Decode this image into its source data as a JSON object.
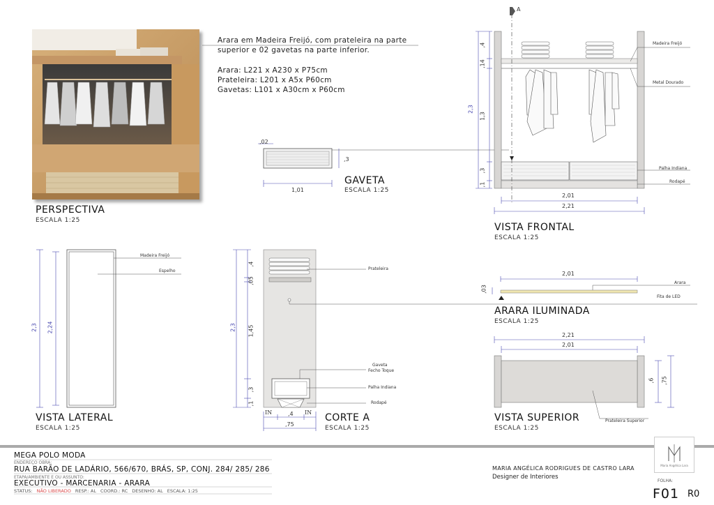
{
  "note": {
    "line1": "Arara em Madeira Freijó, com prateleira na parte",
    "line2": "superior e 02 gavetas na parte inferior.",
    "spec1": "Arara: L221 x A230 x P75cm",
    "spec2": "Prateleira: L201 x A5x P60cm",
    "spec3": "Gavetas: L101 x A30cm x P60cm"
  },
  "views": {
    "perspectiva": {
      "title": "PERSPECTIVA",
      "scale": "ESCALA 1:25"
    },
    "gaveta": {
      "title": "GAVETA",
      "scale": "ESCALA 1:25",
      "dim_w": "1,01",
      "dim_h": ",3",
      "dim_t": ",02"
    },
    "frontal": {
      "title": "VISTA FRONTAL",
      "scale": "ESCALA 1:25",
      "dim_inner": "2,01",
      "dim_outer": "2,21",
      "dim_h_total": "2,3",
      "dim_top": ",4",
      "dim_gap": ",14",
      "dim_mid": "1,3",
      "dim_drawer": ",3",
      "dim_base": ",1",
      "label_madeira": "Madeira Freijó",
      "label_metal": "Metal Dourado",
      "label_palha": "Palha Indiana",
      "label_rodape": "Rodapé",
      "section_mark": "A"
    },
    "lateral": {
      "title": "VISTA LATERAL",
      "scale": "ESCALA 1:25",
      "dim_total": "2,3",
      "dim_mirror": "2,24",
      "label_madeira": "Madeira Freijó",
      "label_espelho": "Espelho"
    },
    "corte": {
      "title": "CORTE A",
      "scale": "ESCALA 1:25",
      "dim_h_total": "2,3",
      "dim_top": ",4",
      "dim_shelf": ",05",
      "dim_mid": "1,45",
      "dim_drawer": ",3",
      "dim_base": ",1",
      "dim_drawer_w": ",4",
      "dim_depth": ",75",
      "in_left": "IN",
      "in_right": "IN",
      "label_prateleira": "Prateleira",
      "label_gaveta": "Gaveta",
      "label_fecho": "Fecho Toque",
      "label_palha": "Palha Indiana",
      "label_rodape": "Rodapé"
    },
    "arara": {
      "title": "ARARA ILUMINADA",
      "scale": "ESCALA 1:25",
      "dim_w": "2,01",
      "dim_h": ",03",
      "label_arara": "Arara",
      "label_led": "Fita de LED"
    },
    "superior": {
      "title": "VISTA SUPERIOR",
      "scale": "ESCALA 1:25",
      "dim_outer": "2,21",
      "dim_inner": "2,01",
      "dim_d1": ",6",
      "dim_d2": ",75",
      "label_prateleira": "Prateleira Superior"
    }
  },
  "titleblock": {
    "project": "MEGA POLO MODA",
    "addr_label": "ENDEREÇO OBRA:",
    "address": "RUA BARÃO DE LADÁRIO, 566/670, BRÁS, SP, CONJ. 284/ 285/ 286",
    "stage_label": "ETAPA/AMBIENTE E OU ASSUNTO:",
    "stage": "EXECUTIVO - MARCENARIA - ARARA",
    "status_label": "STATUS:",
    "status": "NÃO LIBERADO",
    "resp": "RESP.: AL",
    "coord": "COORD.: RC",
    "desenho": "DESENHO: AL",
    "escala": "ESCALA: 1:25",
    "designer": "MARIA ANGÉLICA RODRIGUES DE CASTRO LARA",
    "role": "Designer de Interiores",
    "logo_text": "Maria Angélica Lara",
    "folha_label": "FOLHA:",
    "sheet": "F01",
    "rev": "R0"
  },
  "colors": {
    "wood": "#c79a62",
    "dim_blue": "#4a4ab0",
    "accent_red": "#d94a4a",
    "frame_gray": "#d8d6d4"
  }
}
